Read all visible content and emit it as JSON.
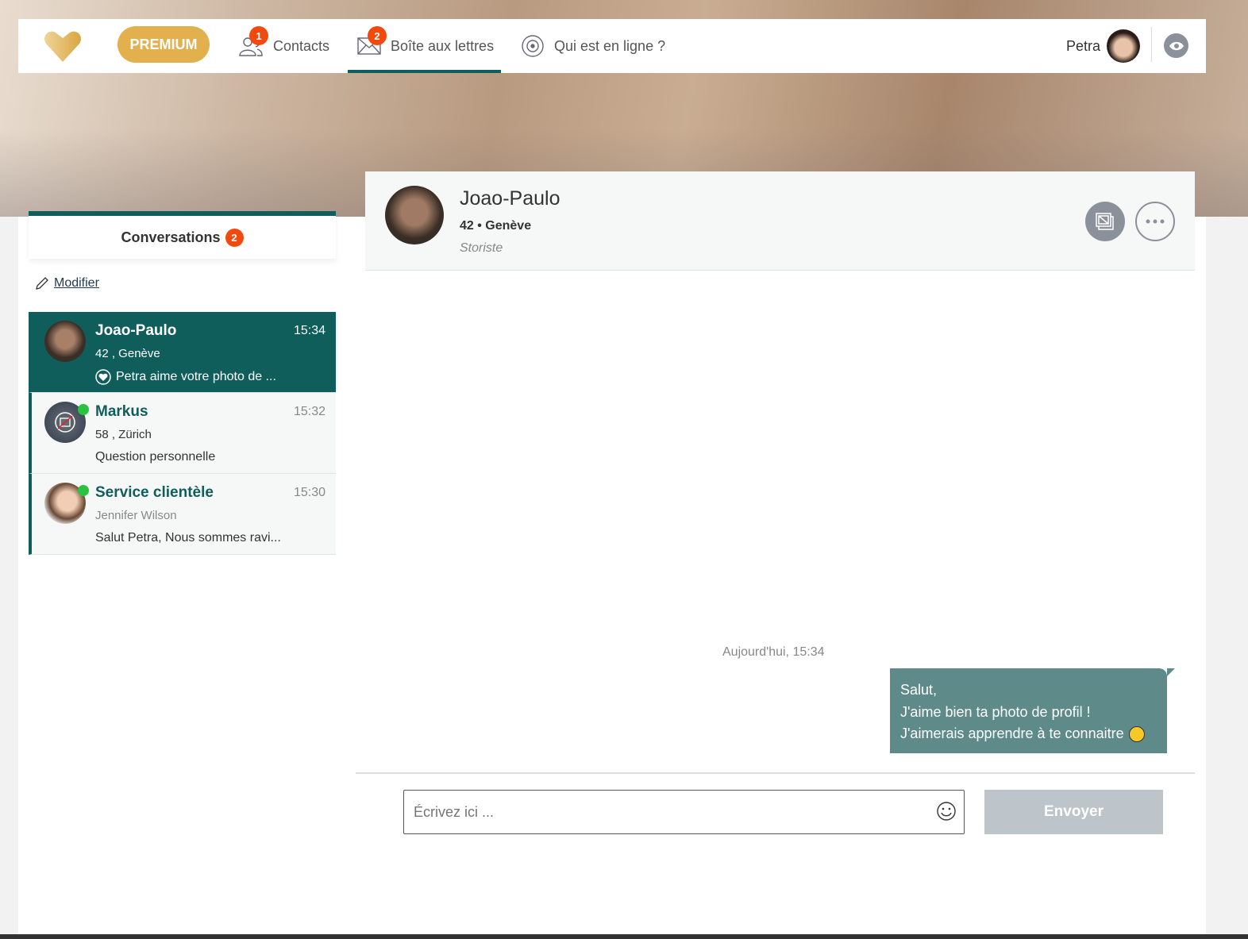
{
  "nav": {
    "premium": "PREMIUM",
    "contacts": {
      "label": "Contacts",
      "badge": "1"
    },
    "mailbox": {
      "label": "Boîte aux lettres",
      "badge": "2"
    },
    "online": {
      "label": "Qui est en ligne ?"
    },
    "user": "Petra"
  },
  "sidebar": {
    "title": "Conversations",
    "badge": "2",
    "edit": "Modifier",
    "items": [
      {
        "name": "Joao-Paulo",
        "time": "15:34",
        "sub": "42 , Genève",
        "msg": "Petra aime votre photo de ...",
        "selected": true
      },
      {
        "name": "Markus",
        "time": "15:32",
        "sub": "58 , Zürich",
        "msg": "Question personnelle",
        "online": true
      },
      {
        "name": "Service clientèle",
        "time": "15:30",
        "sub": "Jennifer Wilson",
        "msg": "Salut Petra, Nous sommes ravi...",
        "online": true
      }
    ]
  },
  "chat": {
    "name": "Joao-Paulo",
    "meta": "42 • Genève",
    "job": "Storiste",
    "timestamp": "Aujourd'hui, 15:34",
    "message": [
      "Salut,",
      "J'aime bien ta photo de profil !",
      "J'aimerais apprendre à te connaitre"
    ],
    "input_placeholder": "Écrivez ici ...",
    "send": "Envoyer"
  },
  "colors": {
    "accent": "#0f5e5c",
    "premium": "#e3b04e",
    "badge": "#f2490f",
    "bubble": "#5e8a8a",
    "online": "#2ac33d"
  }
}
